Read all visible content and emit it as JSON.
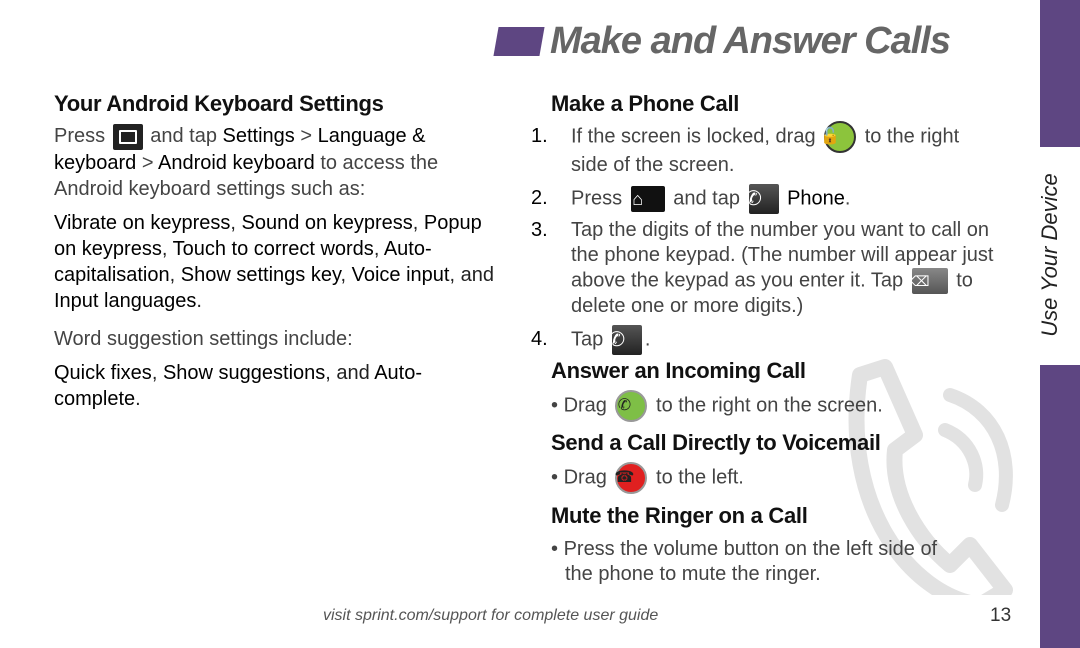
{
  "header": {
    "title": "Make and Answer Calls",
    "accent_color": "#5e4682"
  },
  "side_tab": {
    "label": "Use Your Device"
  },
  "left": {
    "heading": "Your Android Keyboard Settings",
    "para1": {
      "t1": "Press",
      "icon": "menu-key-icon",
      "t2": " and tap ",
      "b1": "Settings",
      "sep1": " > ",
      "b2": "Language & keyboard",
      "sep2": " > ",
      "b3": "Android keyboard",
      "t3": " to access the Android keyboard settings such as:"
    },
    "para2": {
      "b1": "Vibrate on keypress",
      "s1": ", ",
      "b2": "Sound on keypress",
      "s2": ", ",
      "b3": "Popup on keypress",
      "s3": ", ",
      "b4": "Touch to correct words",
      "s4": ", ",
      "b5": "Auto-capitalisation",
      "s5": ", ",
      "b6": "Show settings key",
      "s6": ", ",
      "b7": "Voice input",
      "s7": ", and ",
      "b8": "Input languages",
      "s8": "."
    },
    "para3": "Word suggestion settings include:",
    "para4": {
      "b1": "Quick fixes",
      "s1": ", ",
      "b2": "Show suggestions",
      "s2": ", and ",
      "b3": "Auto-complete",
      "s3": "."
    }
  },
  "right": {
    "make_call": {
      "heading": "Make a Phone Call",
      "step1": {
        "num": "1.",
        "t1": "If the screen is locked, drag ",
        "icon": "unlock-icon",
        "t2": " to the right side of the screen."
      },
      "step2": {
        "num": "2.",
        "t1": "Press ",
        "icon1": "home-key-icon",
        "t2": " and tap ",
        "icon2": "phone-app-icon",
        "b1": " Phone",
        "t3": "."
      },
      "step3": {
        "num": "3.",
        "t1": "Tap the digits of the number you want to call on the phone keypad. (The number will appear just above the keypad as you enter it. Tap ",
        "icon": "delete-key-icon",
        "t2": " to delete one or more digits.)"
      },
      "step4": {
        "num": "4.",
        "t1": "Tap ",
        "icon": "call-button-icon",
        "t2": "."
      }
    },
    "answer_call": {
      "heading": "Answer an Incoming Call",
      "bullet": {
        "t1": "Drag ",
        "icon": "answer-icon",
        "t2": " to the right on the screen."
      }
    },
    "voicemail": {
      "heading": "Send a Call Directly to Voicemail",
      "bullet": {
        "t1": "Drag ",
        "icon": "decline-icon",
        "t2": " to the left."
      }
    },
    "mute": {
      "heading": "Mute the Ringer on a Call",
      "bullet": {
        "t1": "Press the volume button on the left side of the phone to mute the ringer."
      }
    }
  },
  "footer": {
    "text": "visit sprint.com/support for complete user guide",
    "page_number": "13"
  },
  "watermark": {
    "icon": "phone-handset-icon"
  }
}
